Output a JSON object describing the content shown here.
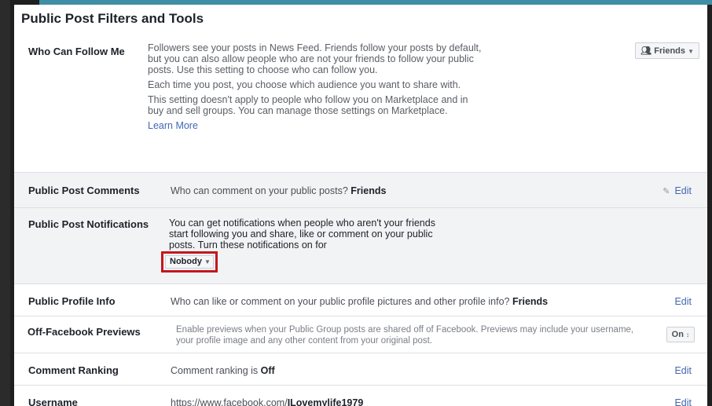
{
  "title": "Public Post Filters and Tools",
  "who_can_follow": {
    "label": "Who Can Follow Me",
    "para1": "Followers see your posts in News Feed. Friends follow your posts by default, but you can also allow people who are not your friends to follow your public posts. Use this setting to choose who can follow you.",
    "para2": "Each time you post, you choose which audience you want to share with.",
    "para3": "This setting doesn't apply to people who follow you on Marketplace and in buy and sell groups. You can manage those settings on Marketplace.",
    "learn_more": "Learn More",
    "selector": "Friends",
    "selector_icon": "friends-icon"
  },
  "comments": {
    "label": "Public Post Comments",
    "text": "Who can comment on your public posts?",
    "value": "Friends",
    "edit": "Edit"
  },
  "notifications": {
    "label": "Public Post Notifications",
    "text": "You can get notifications when people who aren't your friends start following you and share, like or comment on your public posts. Turn these notifications on for",
    "selector": "Nobody",
    "highlight_color": "#c4161c"
  },
  "profile_info": {
    "label": "Public Profile Info",
    "text": "Who can like or comment on your public profile pictures and other profile info?",
    "value": "Friends",
    "edit": "Edit"
  },
  "off_facebook": {
    "label": "Off-Facebook Previews",
    "text": "Enable previews when your Public Group posts are shared off of Facebook. Previews may include your username, your profile image and any other content from your original post.",
    "selector": "On"
  },
  "ranking": {
    "label": "Comment Ranking",
    "text": "Comment ranking is",
    "value": "Off",
    "edit": "Edit"
  },
  "username": {
    "label": "Username",
    "url_prefix": "https://www.facebook.com/",
    "url_name": "ILovemylife1979",
    "edit": "Edit"
  },
  "colors": {
    "link": "#4267b2",
    "band": "#3f8ea6"
  }
}
